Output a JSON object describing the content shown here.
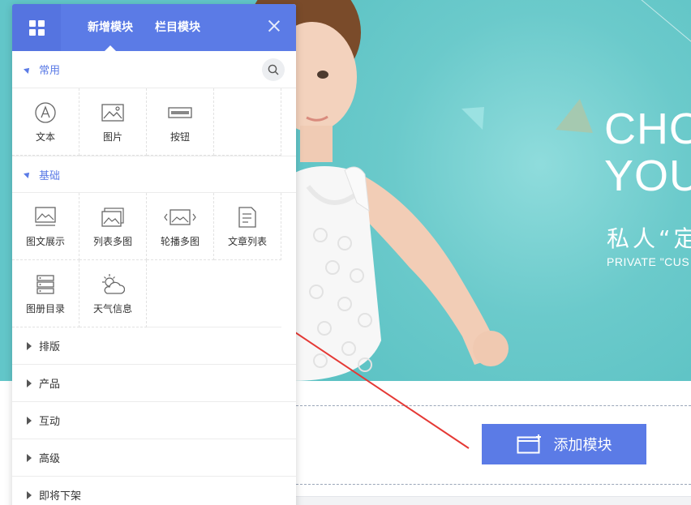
{
  "panel": {
    "tabs": [
      {
        "label": "新增模块",
        "active": true
      },
      {
        "label": "栏目模块",
        "active": false
      }
    ],
    "sections": [
      {
        "label": "常用",
        "items": [
          {
            "label": "文本",
            "icon": "text-icon"
          },
          {
            "label": "图片",
            "icon": "image-icon"
          },
          {
            "label": "按钮",
            "icon": "button-icon"
          }
        ]
      },
      {
        "label": "基础",
        "items": [
          {
            "label": "图文展示",
            "icon": "image-text-icon"
          },
          {
            "label": "列表多图",
            "icon": "multi-image-list-icon"
          },
          {
            "label": "轮播多图",
            "icon": "carousel-icon"
          },
          {
            "label": "文章列表",
            "icon": "article-list-icon"
          },
          {
            "label": "图册目录",
            "icon": "album-catalog-icon"
          },
          {
            "label": "天气信息",
            "icon": "weather-icon"
          }
        ]
      }
    ],
    "collapsed_sections": [
      "排版",
      "产品",
      "互动",
      "高级",
      "即将下架"
    ]
  },
  "banner": {
    "headline_line1": "CHO",
    "headline_line2": "YOU",
    "subtitle_zh": "私人“定",
    "subtitle_en": "PRIVATE \"CUS"
  },
  "add_module_button": {
    "label": "添加模块"
  },
  "colors": {
    "accent": "#5b7be6",
    "banner_bg": "#62c6c9",
    "arrow": "#e53935"
  }
}
